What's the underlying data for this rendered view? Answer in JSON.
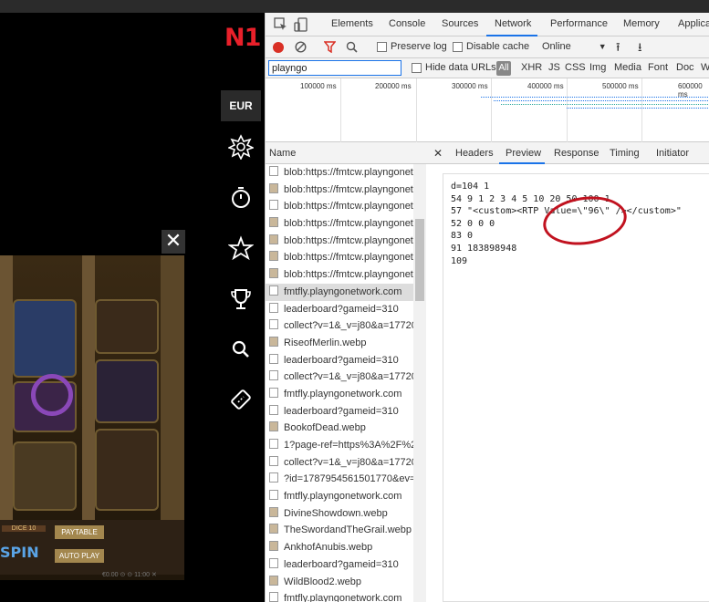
{
  "casino": {
    "logo": "N1",
    "currency": "EUR",
    "nav_icons": [
      "cog-star-icon",
      "stopwatch-icon",
      "star-icon",
      "trophy-icon",
      "search-icon",
      "ticket-icon"
    ],
    "close_symbol": "✕",
    "game": {
      "spin": "SPIN",
      "dice": "DICE 10",
      "paytable": "PAYTABLE",
      "autoplay": "AUTO PLAY",
      "status": "€0.00 ⊙ ⊙ 11:00 ✕"
    }
  },
  "devtools": {
    "tabs": [
      "Elements",
      "Console",
      "Sources",
      "Network",
      "Performance",
      "Memory",
      "Applica"
    ],
    "active_tab": "Network",
    "toolbar": {
      "preserve_log": "Preserve log",
      "disable_cache": "Disable cache",
      "throttle": "Online"
    },
    "filter": {
      "value": "playngo",
      "hide_data_urls": "Hide data URLs",
      "all": "All",
      "types": [
        "XHR",
        "JS",
        "CSS",
        "Img",
        "Media",
        "Font",
        "Doc",
        "W"
      ]
    },
    "timeline_ticks": [
      "100000 ms",
      "200000 ms",
      "300000 ms",
      "400000 ms",
      "500000 ms",
      "600000 ms"
    ],
    "name_header": "Name",
    "requests": [
      {
        "name": "blob:https://fmtcw.playngonet",
        "img": false
      },
      {
        "name": "blob:https://fmtcw.playngonet",
        "img": true
      },
      {
        "name": "blob:https://fmtcw.playngonet",
        "img": false
      },
      {
        "name": "blob:https://fmtcw.playngonet",
        "img": true
      },
      {
        "name": "blob:https://fmtcw.playngonet",
        "img": true
      },
      {
        "name": "blob:https://fmtcw.playngonet",
        "img": true
      },
      {
        "name": "blob:https://fmtcw.playngonet",
        "img": true
      },
      {
        "name": "fmtfly.playngonetwork.com",
        "img": false,
        "selected": true
      },
      {
        "name": "leaderboard?gameid=310",
        "img": false
      },
      {
        "name": "collect?v=1&_v=j80&a=17720",
        "img": false
      },
      {
        "name": "RiseofMerlin.webp",
        "img": true
      },
      {
        "name": "leaderboard?gameid=310",
        "img": false
      },
      {
        "name": "collect?v=1&_v=j80&a=17720",
        "img": false
      },
      {
        "name": "fmtfly.playngonetwork.com",
        "img": false
      },
      {
        "name": "leaderboard?gameid=310",
        "img": false
      },
      {
        "name": "BookofDead.webp",
        "img": true
      },
      {
        "name": "1?page-ref=https%3A%2F%2F",
        "img": false
      },
      {
        "name": "collect?v=1&_v=j80&a=17720",
        "img": false
      },
      {
        "name": "?id=1787954561501770&ev=",
        "img": false
      },
      {
        "name": "fmtfly.playngonetwork.com",
        "img": false
      },
      {
        "name": "DivineShowdown.webp",
        "img": true
      },
      {
        "name": "TheSwordandTheGrail.webp",
        "img": true
      },
      {
        "name": "AnkhofAnubis.webp",
        "img": true
      },
      {
        "name": "leaderboard?gameid=310",
        "img": false
      },
      {
        "name": "WildBlood2.webp",
        "img": true
      },
      {
        "name": "fmtfly.playngonetwork.com",
        "img": false
      }
    ],
    "detail_tabs": [
      "Headers",
      "Preview",
      "Response",
      "Timing",
      "Initiator"
    ],
    "detail_close": "✕",
    "active_detail_tab": "Preview",
    "preview_lines": [
      "d=104 1",
      "54 9 1 2 3 4 5 10 20 50 100 1",
      "57 \"<custom><RTP Value=\\\"96\\\" /></custom>\"",
      "52 0 0 0",
      "83 0",
      "91 183898948",
      "109"
    ],
    "annotation_color": "#c1121f"
  }
}
